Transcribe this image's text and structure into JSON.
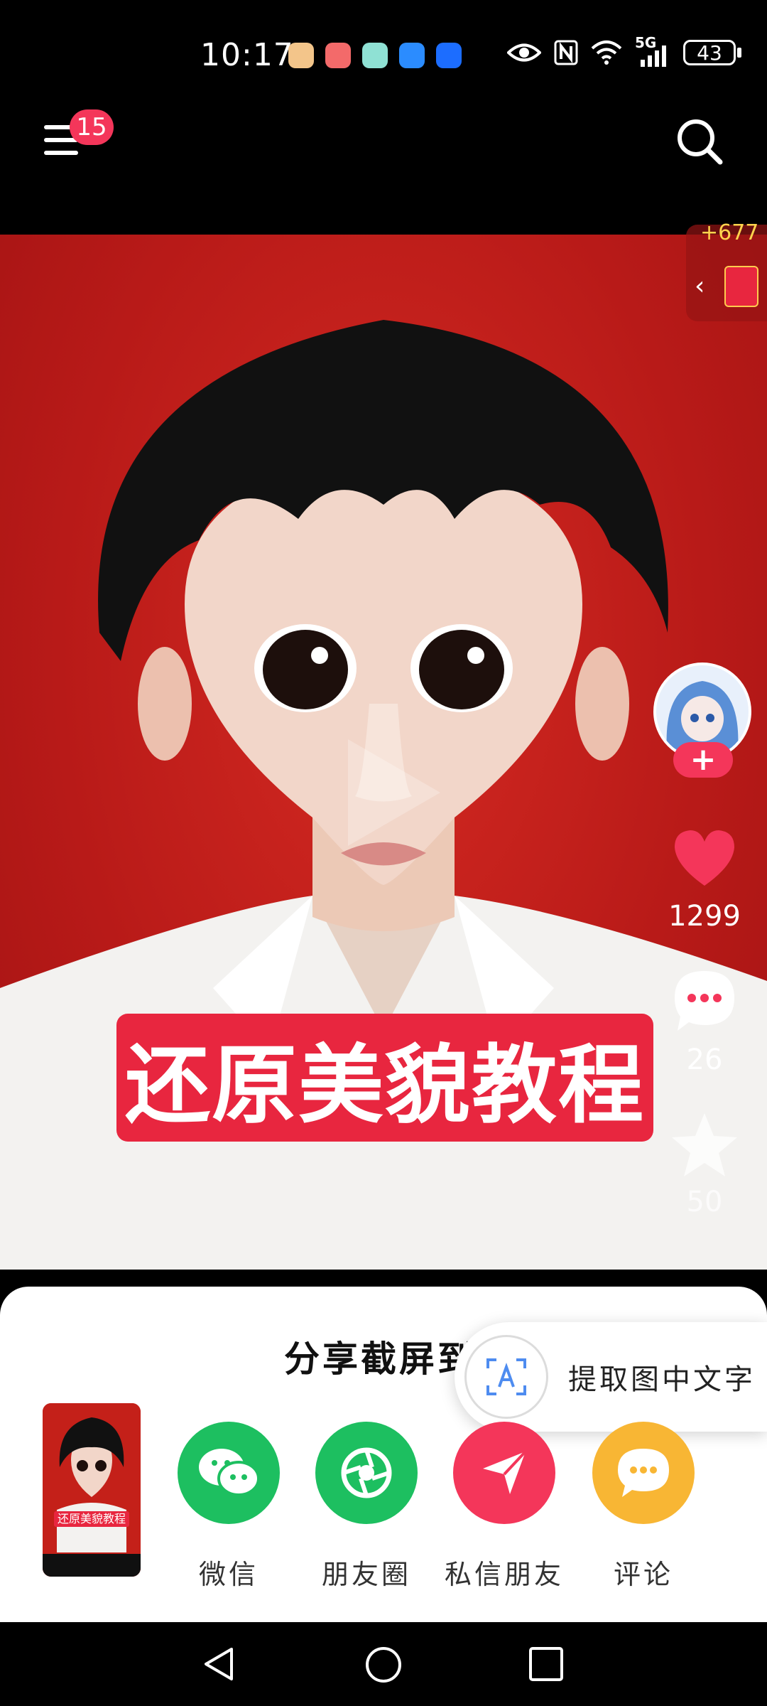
{
  "status_bar": {
    "time": "10:17",
    "network": "5G",
    "battery": "43"
  },
  "top_nav": {
    "notification_count": "15"
  },
  "reward": {
    "points": "+677"
  },
  "video": {
    "caption": "还原美貌教程"
  },
  "actions": {
    "follow_symbol": "+",
    "likes": "1299",
    "comments": "26",
    "favorites": "50"
  },
  "share_sheet": {
    "title": "分享截屏到",
    "extract_text_label": "提取图中文字",
    "thumbnail_caption": "还原美貌教程",
    "targets": [
      {
        "label": "微信",
        "color": "#1dbf60"
      },
      {
        "label": "朋友圈",
        "color": "#1dbf60"
      },
      {
        "label": "私信朋友",
        "color": "#f4365a"
      },
      {
        "label": "评论",
        "color": "#f8b634"
      }
    ]
  },
  "colors": {
    "accent": "#f4365a",
    "video_bg": "#c42019",
    "wechat_green": "#1dbf60",
    "comment_yellow": "#f8b634"
  }
}
